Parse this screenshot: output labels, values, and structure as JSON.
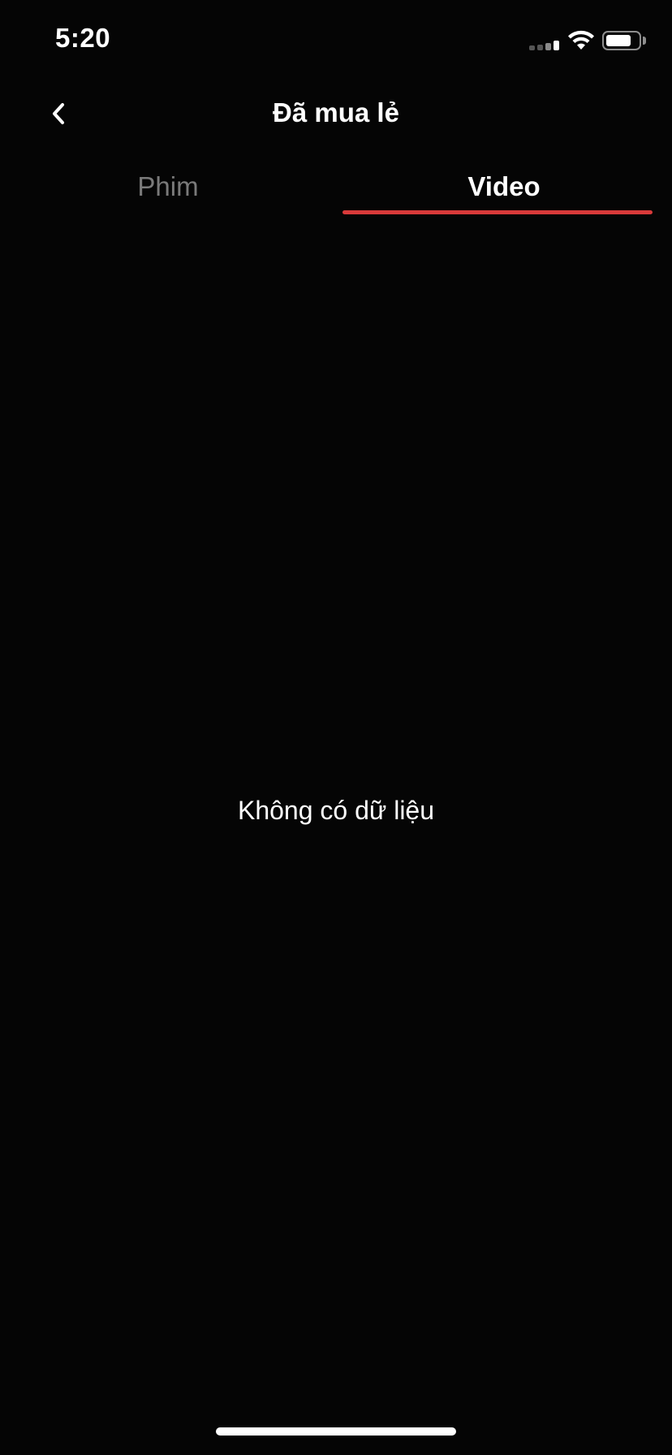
{
  "status_bar": {
    "time": "5:20",
    "battery_level": 0.8
  },
  "header": {
    "title": "Đã mua lẻ",
    "back_icon": "chevron-left-icon"
  },
  "tabs": [
    {
      "label": "Phim",
      "active": false
    },
    {
      "label": "Video",
      "active": true
    }
  ],
  "main": {
    "empty_message": "Không có dữ liệu"
  },
  "colors": {
    "background": "#050505",
    "accent": "#d93a3a",
    "inactive_tab": "#7a7a7a",
    "text": "#ffffff"
  }
}
